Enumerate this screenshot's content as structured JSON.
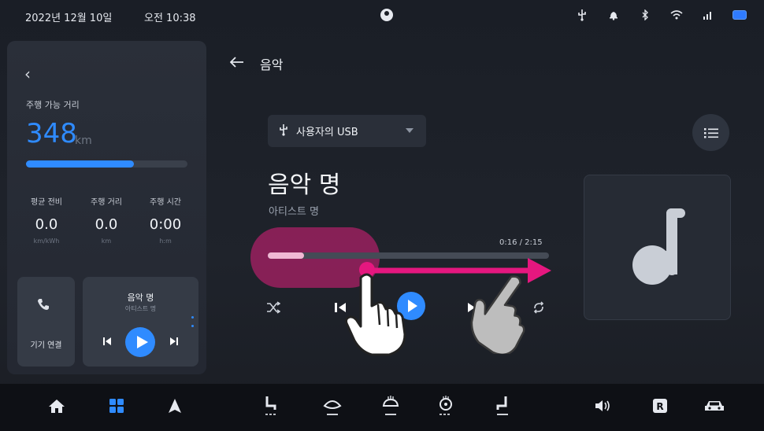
{
  "status": {
    "date": "2022년 12월 10일",
    "time": "오전 10:38"
  },
  "left_panel": {
    "range_label": "주행 가능 거리",
    "range_value": "348",
    "range_unit": "km",
    "range_level": 0.67,
    "stats": [
      {
        "label": "평균 전비",
        "value": "0.0",
        "unit": "km/kWh"
      },
      {
        "label": "주행 거리",
        "value": "0.0",
        "unit": "km"
      },
      {
        "label": "주행 시간",
        "value": "0:00",
        "unit": "h:m"
      }
    ],
    "phone_card_label": "기기 연결",
    "mini_player": {
      "title": "음악 명",
      "artist": "아티스트 명"
    }
  },
  "header": {
    "title": "음악"
  },
  "player": {
    "source_label": "사용자의 USB",
    "song_title": "음악 명",
    "artist": "아티스트 명",
    "time": "0:16 / 2:15",
    "progress": 0.13
  },
  "colors": {
    "accent": "#2f8bff",
    "gesture_pink": "#e5177f",
    "background": "#1d2129"
  },
  "icons": {
    "status": [
      "usb-icon",
      "bell-icon",
      "bluetooth-icon",
      "wifi-icon",
      "signal-icon",
      "battery-icon"
    ],
    "dock": [
      "home-icon",
      "apps-icon",
      "navigation-icon",
      "seat-heat-icon",
      "windshield-defrost-icon",
      "rear-defrost-icon",
      "steering-heat-icon",
      "seat-vent-icon",
      "volume-icon",
      "rear-camera-icon",
      "car-icon"
    ]
  }
}
